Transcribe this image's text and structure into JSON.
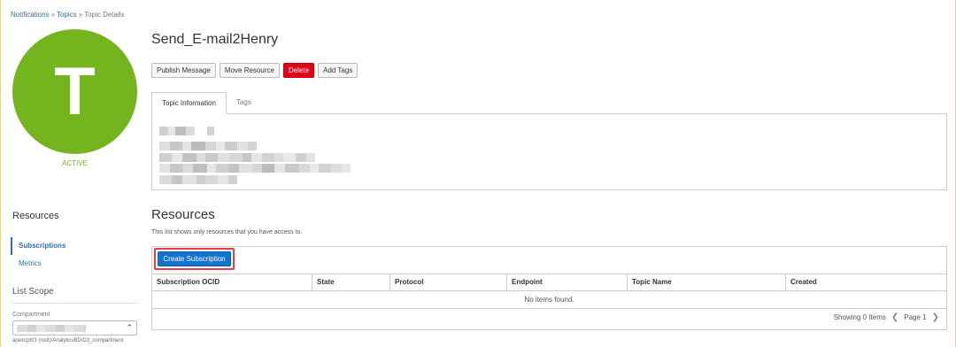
{
  "breadcrumb": {
    "items": [
      "Notifications",
      "Topics",
      "Topic Details"
    ],
    "separator": "»"
  },
  "avatar": {
    "letter": "T",
    "status": "ACTIVE",
    "color": "#74b41f"
  },
  "topic": {
    "title": "Send_E-mail2Henry"
  },
  "actions": {
    "publish": "Publish Message",
    "move": "Move Resource",
    "delete": "Delete",
    "add_tags": "Add Tags"
  },
  "tabs": {
    "info": "Topic Information",
    "tags": "Tags"
  },
  "sidebar": {
    "resources_title": "Resources",
    "items": [
      {
        "label": "Subscriptions",
        "active": true
      },
      {
        "label": "Metrics",
        "active": false
      }
    ],
    "list_scope": "List Scope",
    "compartment_label": "Compartment",
    "compartment_path": "apexcpt03 (root)/AnalyticsBD/D3_compartment"
  },
  "resources": {
    "title": "Resources",
    "description": "This list shows only resources that you have access to.",
    "create_button": "Create Subscription",
    "columns": [
      "Subscription OCID",
      "State",
      "Protocol",
      "Endpoint",
      "Topic Name",
      "Created"
    ],
    "empty_message": "No items found.",
    "showing": "Showing 0 Items",
    "page": "Page 1"
  },
  "colors": {
    "accent": "#1373cf",
    "danger": "#e0001b",
    "link": "#2a6fb5",
    "highlight": "#e0404a"
  }
}
